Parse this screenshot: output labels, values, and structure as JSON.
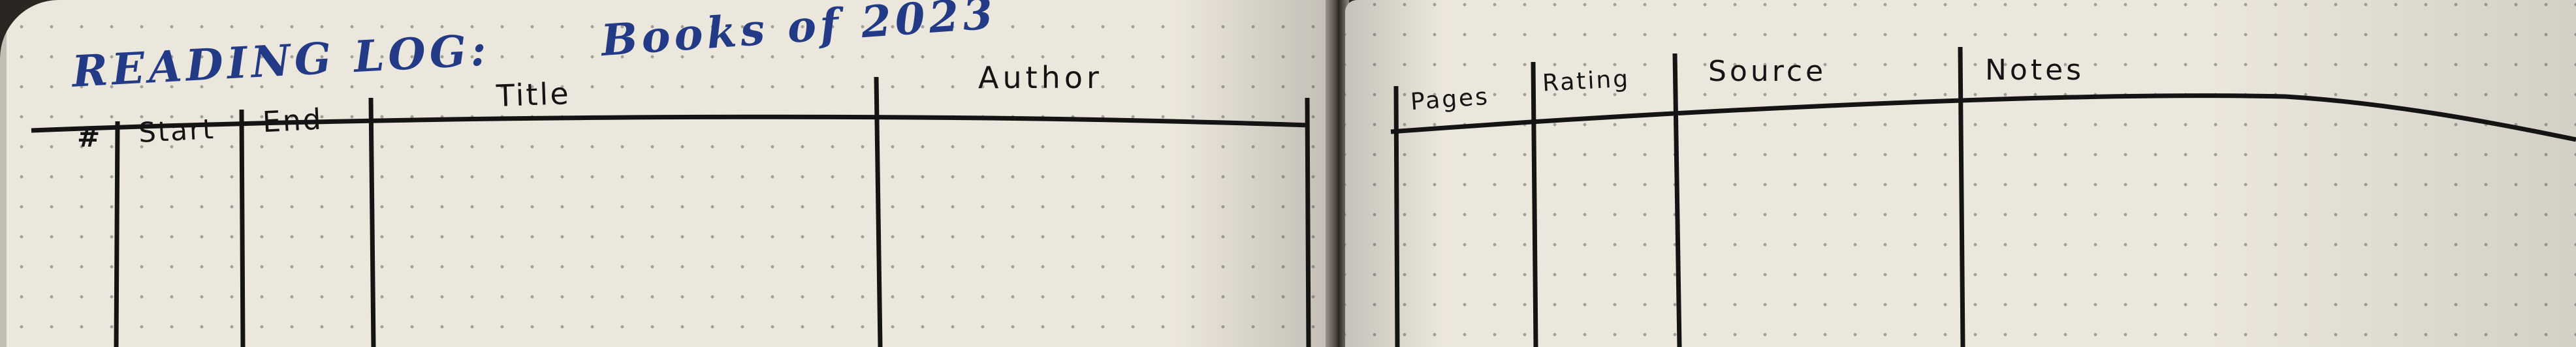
{
  "title": {
    "line1": "READING LOG:",
    "line2": "Books of 2023"
  },
  "left_page": {
    "columns": [
      "#",
      "Start",
      "End",
      "Title",
      "Author"
    ]
  },
  "right_page": {
    "columns": [
      "Pages",
      "Rating",
      "Source",
      "Notes"
    ]
  },
  "colors": {
    "paper": "#ece7dc",
    "title_ink": "#233b86",
    "line_ink": "#141414",
    "background": "#2b2622"
  }
}
